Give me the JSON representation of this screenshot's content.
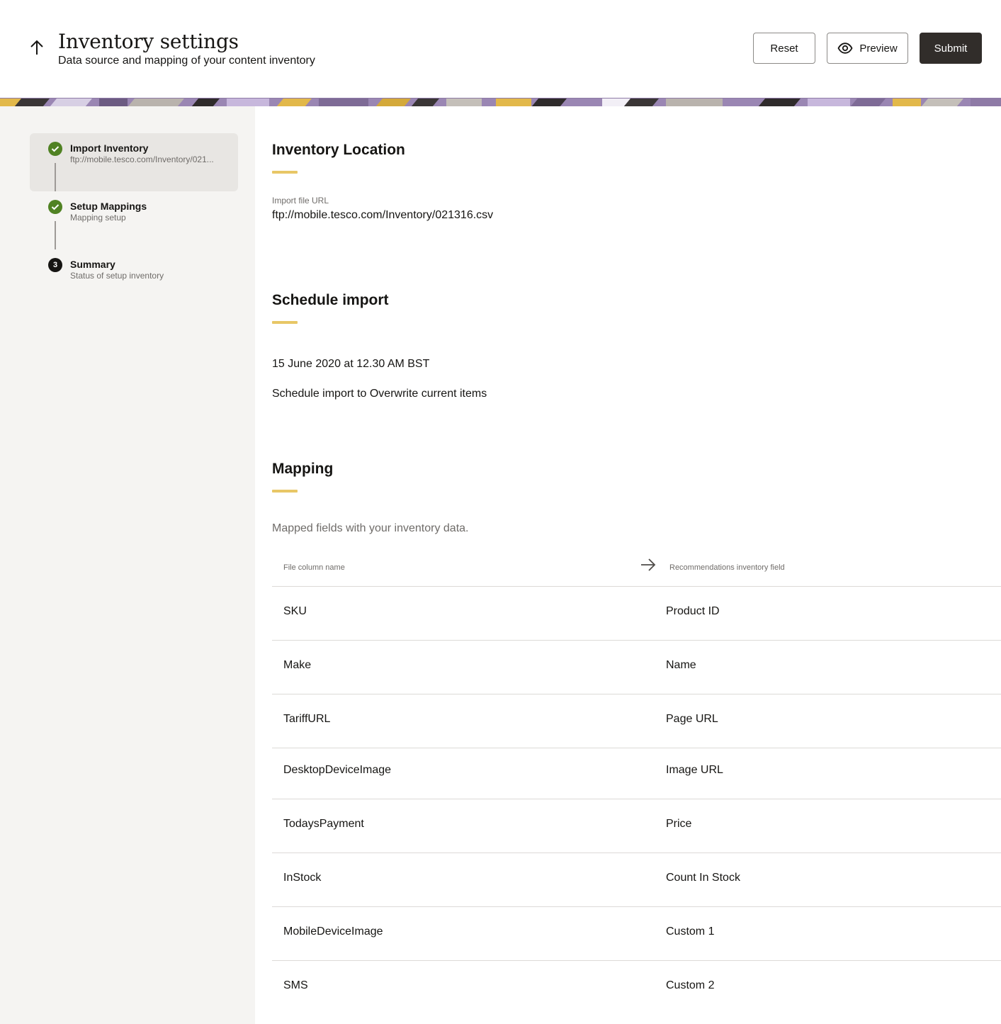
{
  "header": {
    "title": "Inventory settings",
    "subtitle": "Data source and mapping of your content inventory",
    "back_icon": "arrow-up-icon",
    "buttons": {
      "reset": "Reset",
      "preview": "Preview",
      "submit": "Submit"
    }
  },
  "sidebar": {
    "steps": [
      {
        "title": "Import Inventory",
        "subtitle": "ftp://mobile.tesco.com/Inventory/021...",
        "state": "done"
      },
      {
        "title": "Setup Mappings",
        "subtitle": "Mapping setup",
        "state": "done"
      },
      {
        "title": "Summary",
        "subtitle": "Status of setup inventory",
        "state": "active",
        "number": "3"
      }
    ]
  },
  "inventory_location": {
    "title": "Inventory Location",
    "url_label": "Import file URL",
    "url_value": "ftp://mobile.tesco.com/Inventory/021316.csv"
  },
  "schedule": {
    "title": "Schedule import",
    "date": "15 June 2020 at 12.30 AM BST",
    "mode": "Schedule import to Overwrite current items"
  },
  "mapping": {
    "title": "Mapping",
    "description": "Mapped fields with your inventory data.",
    "columns": [
      "File column name",
      "Recommendations inventory field"
    ],
    "rows": [
      [
        "SKU",
        "Product ID"
      ],
      [
        "Make",
        "Name"
      ],
      [
        "TariffURL",
        "Page URL"
      ],
      [
        "DesktopDeviceImage",
        "Image URL"
      ],
      [
        "TodaysPayment",
        "Price"
      ],
      [
        "InStock",
        "Count In Stock"
      ],
      [
        "MobileDeviceImage",
        "Custom 1"
      ],
      [
        "SMS",
        "Custom 2"
      ]
    ]
  },
  "colors": {
    "accent": "#e8c766",
    "success": "#508223",
    "primary_button": "#312d2a",
    "sidebar_bg": "#f5f4f2"
  }
}
